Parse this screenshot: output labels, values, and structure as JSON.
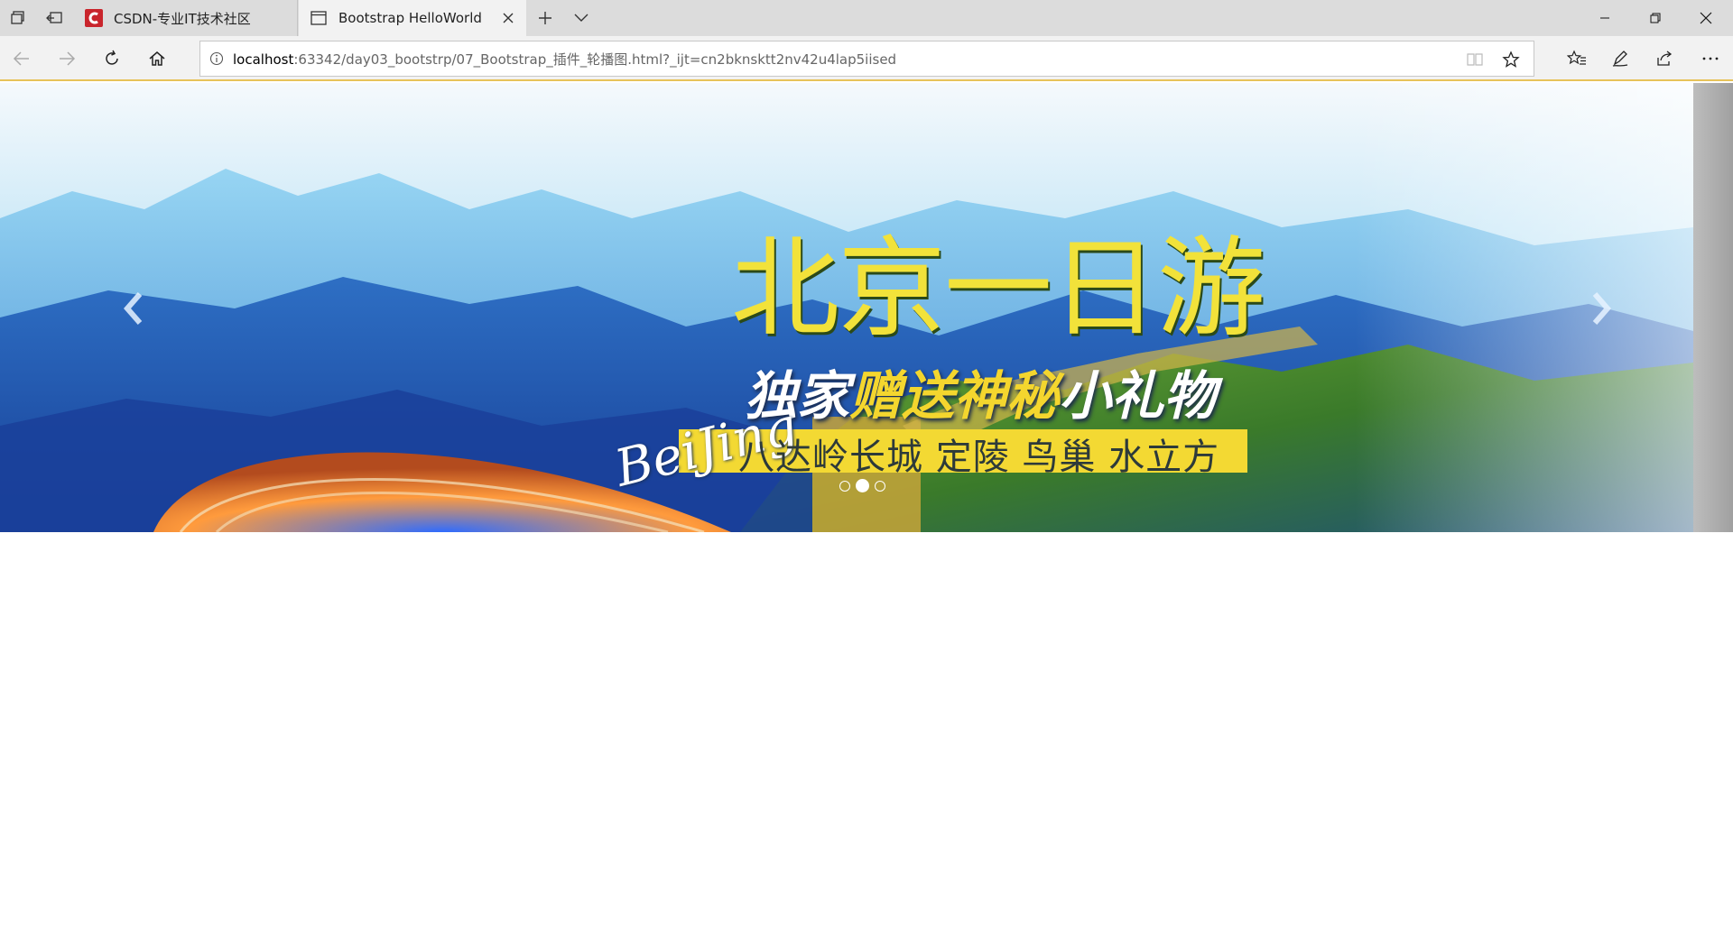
{
  "browser": {
    "tabs": [
      {
        "title": "CSDN-专业IT技术社区",
        "active": false,
        "icon": "csdn-logo-icon"
      },
      {
        "title": "Bootstrap HelloWorld",
        "active": true,
        "icon": "page-icon"
      }
    ],
    "address": {
      "host": "localhost",
      "rest": ":63342/day03_bootstrp/07_Bootstrap_插件_轮播图.html?_ijt=cn2bknsktt2nv42u4lap5iised"
    },
    "colors": {
      "tabbar": "#dcdcdc",
      "toolbar": "#f2f2f2",
      "accent": "#e7c35a",
      "csdn_red": "#c9252c"
    }
  },
  "carousel": {
    "banner": {
      "title": "北京一日游",
      "subtitle_white_1": "独家",
      "subtitle_yellow": "赠送神秘",
      "subtitle_white_2": "小礼物",
      "script_text": "BeiJing",
      "places": "八达岭长城  定陵  鸟巢 水立方"
    },
    "indicators": {
      "count": 3,
      "active_index": 1
    },
    "colors": {
      "banner_yellow": "#f3d933",
      "sky": "#9ed8f5",
      "mountain": "#1f4fae"
    }
  }
}
